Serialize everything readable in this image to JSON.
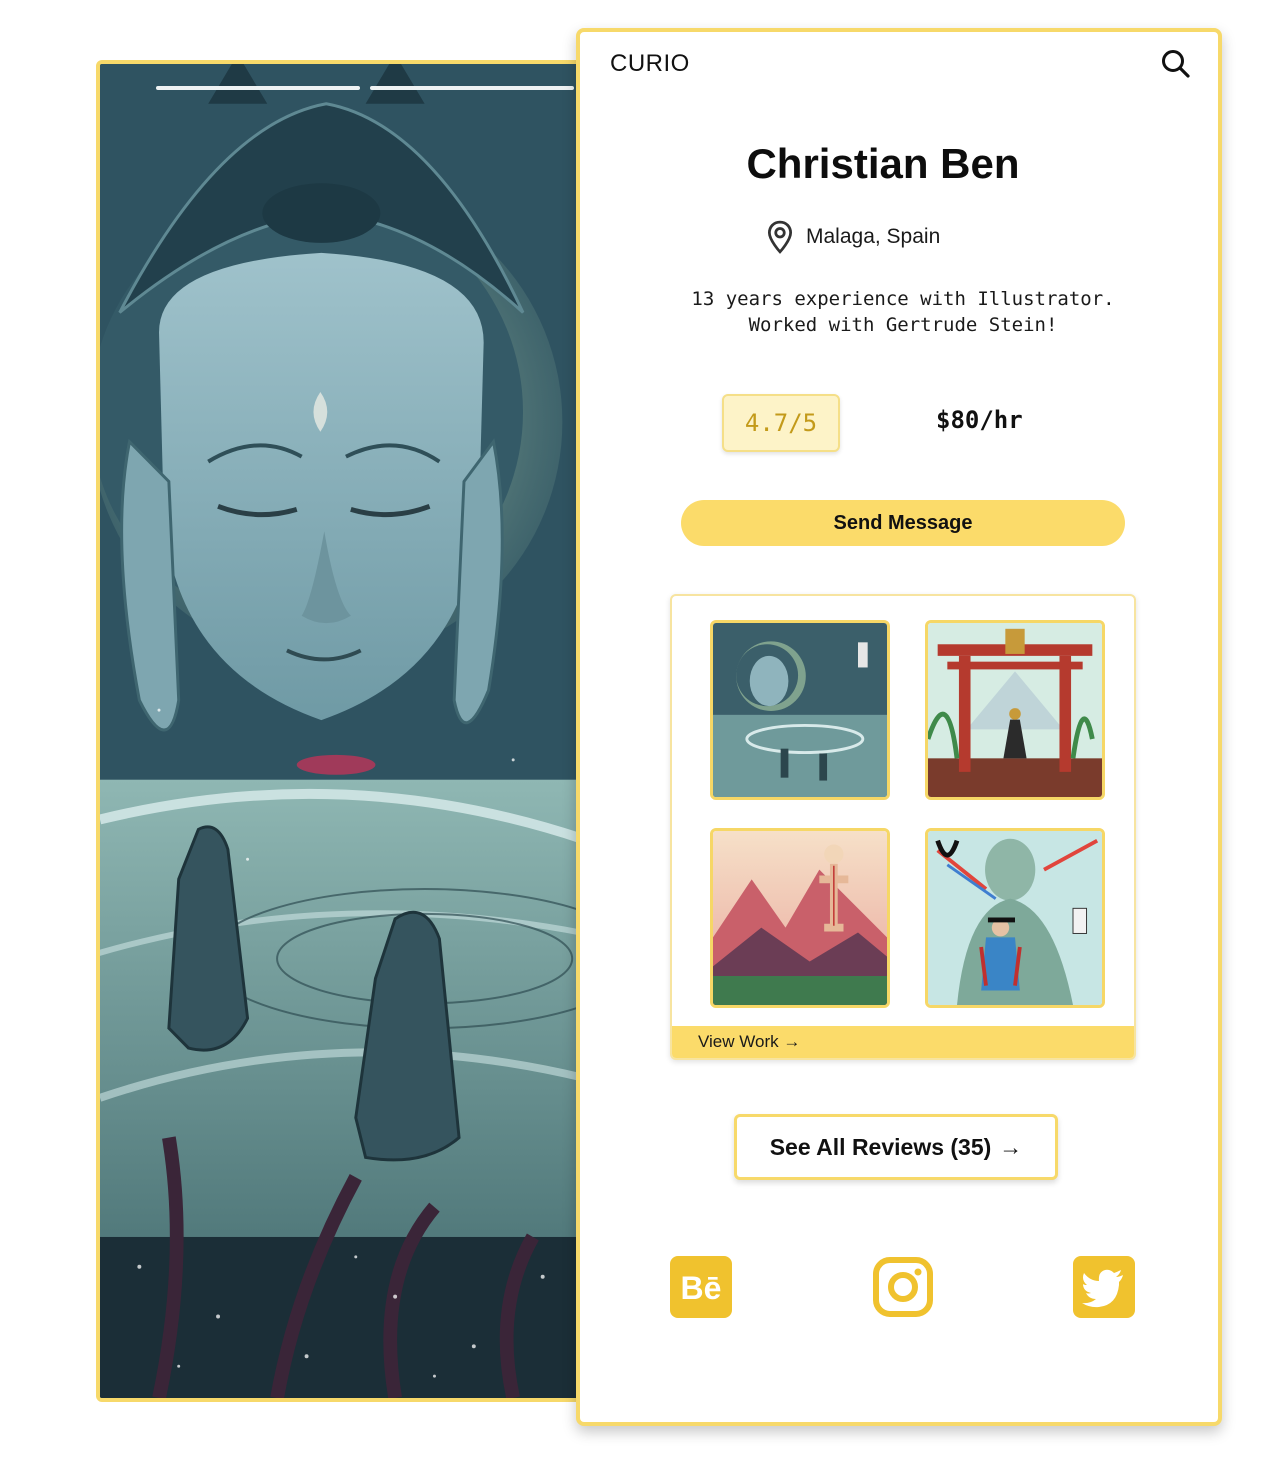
{
  "colors": {
    "accent": "#fbdb6a",
    "border": "#f7d96a",
    "rating_bg": "#fdf3c8",
    "rating_text": "#c39a1a",
    "icon_gold": "#f0c22e"
  },
  "header": {
    "brand": "CURIO",
    "search_icon": "search-icon"
  },
  "profile": {
    "name": "Christian Ben",
    "location": "Malaga, Spain",
    "bio_line1": "13 years experience with Illustrator.",
    "bio_line2": "Worked with Gertrude Stein!",
    "rating": "4.7/5",
    "rate": "$80/hr"
  },
  "actions": {
    "send_message": "Send Message",
    "view_work": "View Work →",
    "see_reviews": "See All Reviews (35)",
    "reviews_arrow": "→"
  },
  "gallery": {
    "thumbnails": [
      "buddha-temple-artwork",
      "torii-gate-artwork",
      "mountain-meditation-artwork",
      "stone-buddha-traveler-artwork"
    ]
  },
  "social": [
    "behance-icon",
    "instagram-icon",
    "twitter-icon"
  ],
  "story": {
    "segments": 2,
    "segment_progress": [
      1,
      1
    ]
  }
}
